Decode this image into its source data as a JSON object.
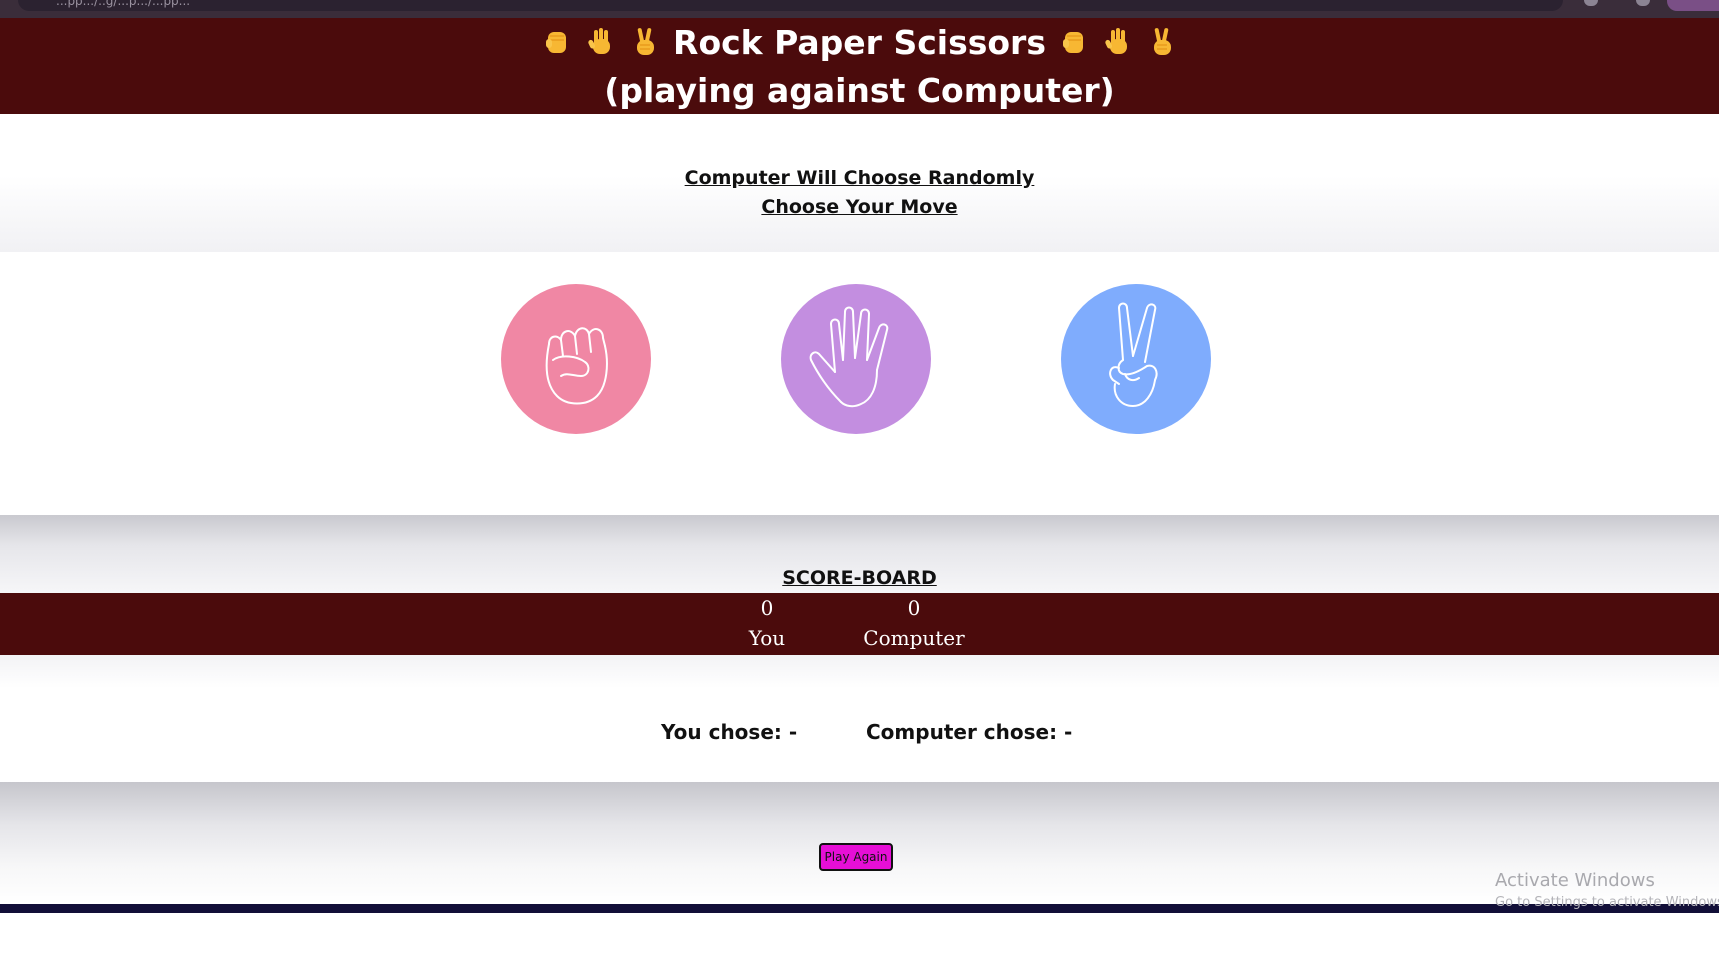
{
  "browser": {
    "address_text": "...pp.../..g/...p.../...pp...",
    "accent_color": "#3a2d3a"
  },
  "header": {
    "title": "Rock Paper Scissors",
    "subtitle": "(playing against Computer)",
    "background_color": "#4b0b0c",
    "emoji_icons": [
      "raised-fist-icon",
      "raised-hand-icon",
      "victory-hand-icon"
    ]
  },
  "instructions": {
    "line1": "Computer Will Choose Randomly",
    "line2": "Choose Your Move"
  },
  "choices": [
    {
      "name": "rock",
      "icon": "fist-icon",
      "color": "#f087a4"
    },
    {
      "name": "paper",
      "icon": "open-hand-icon",
      "color": "#c38ee0"
    },
    {
      "name": "scissors",
      "icon": "victory-hand-icon",
      "color": "#7facfd"
    }
  ],
  "scoreboard": {
    "title": "SCORE-BOARD",
    "you_score": "0",
    "you_label": "You",
    "computer_score": "0",
    "computer_label": "Computer"
  },
  "result": {
    "you_chose": "You chose: -",
    "computer_chose": "Computer chose: -"
  },
  "actions": {
    "play_again_label": "Play Again",
    "play_again_color": "#e60fd6"
  },
  "watermark": {
    "title": "Activate Windows",
    "subtitle": "Go to Settings to activate Windows."
  }
}
